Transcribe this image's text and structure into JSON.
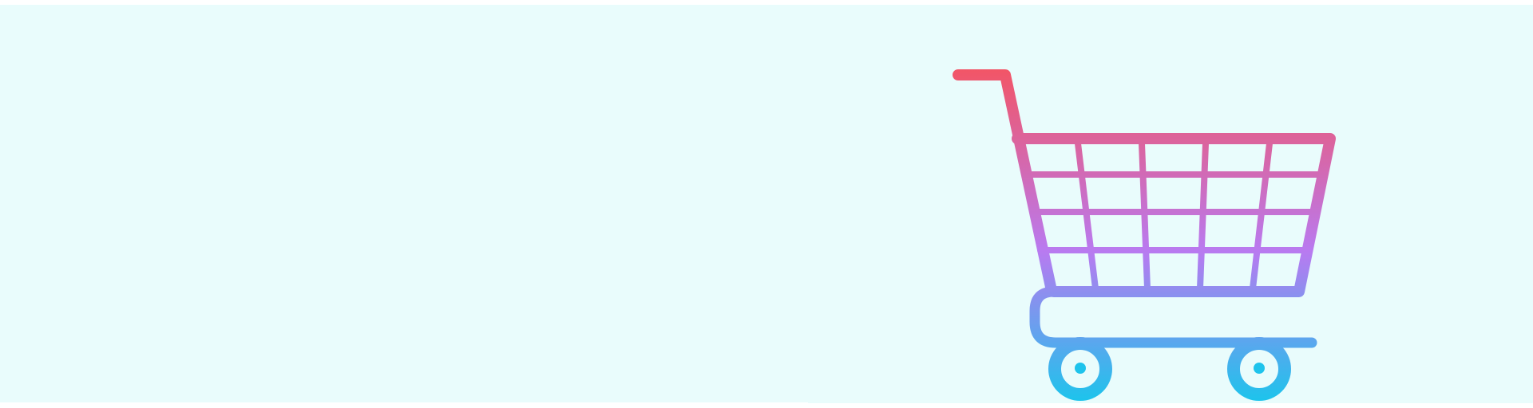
{
  "background_color": "#e9fcfc",
  "illustration": {
    "icon": "shopping-cart-icon",
    "gradient": {
      "start": "#f25566",
      "middle": "#b97af0",
      "end": "#1ec3ec"
    }
  }
}
